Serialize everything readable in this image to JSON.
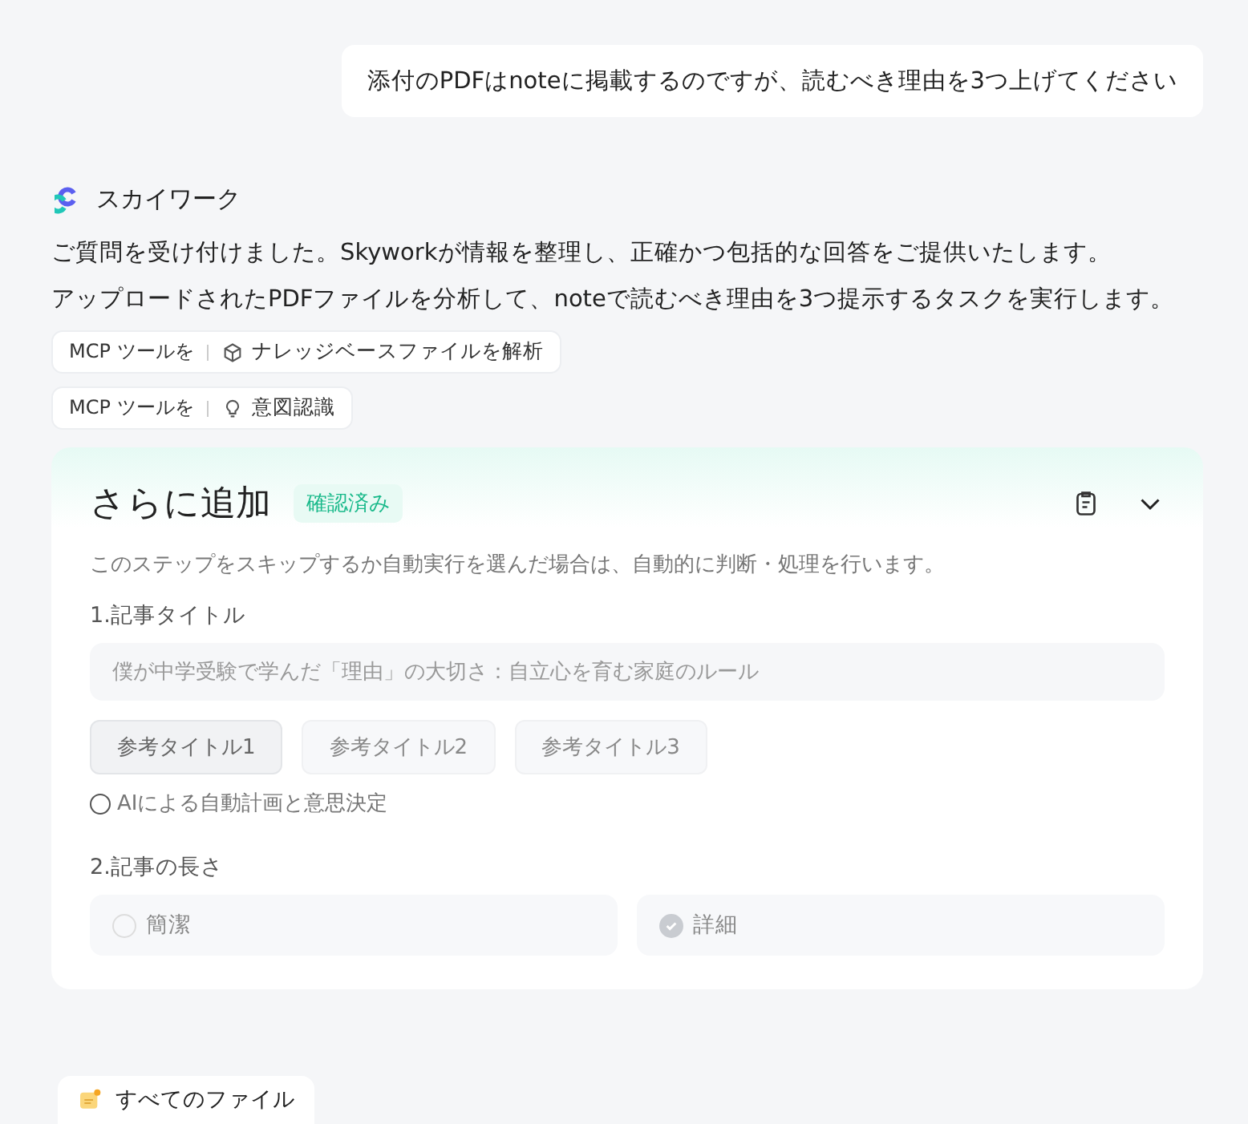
{
  "user_message": "添付のPDFはnoteに掲載するのですが、読むべき理由を3つ上げてください",
  "assistant": {
    "name": "スカイワーク",
    "paragraphs": [
      "ご質問を受け付けました。Skyworkが情報を整理し、正確かつ包括的な回答をご提供いたします。",
      "アップロードされたPDFファイルを分析して、noteで読むべき理由を3つ提示するタスクを実行します。"
    ],
    "tool_calls": [
      {
        "prefix": "MCP ツールを",
        "kind": "cube",
        "label": "ナレッジベースファイルを解析"
      },
      {
        "prefix": "MCP ツールを",
        "kind": "bulb",
        "label": "意図認識"
      }
    ]
  },
  "card": {
    "title": "さらに追加",
    "badge": "確認済み",
    "description": "このステップをスキップするか自動実行を選んだ場合は、自動的に判断・処理を行います。",
    "title_section": {
      "label": "1.記事タイトル",
      "value": "僕が中学受験で学んだ「理由」の大切さ：自立心を育む家庭のルール",
      "options": [
        {
          "label": "参考タイトル1",
          "selected": true
        },
        {
          "label": "参考タイトル2",
          "selected": false
        },
        {
          "label": "参考タイトル3",
          "selected": false
        }
      ],
      "auto": {
        "label": "AIによる自動計画と意思決定",
        "checked": false
      }
    },
    "length_section": {
      "label": "2.記事の長さ",
      "options": [
        {
          "label": "簡潔",
          "selected": false
        },
        {
          "label": "詳細",
          "selected": true
        }
      ]
    }
  },
  "footer": {
    "label": "すべてのファイル"
  }
}
